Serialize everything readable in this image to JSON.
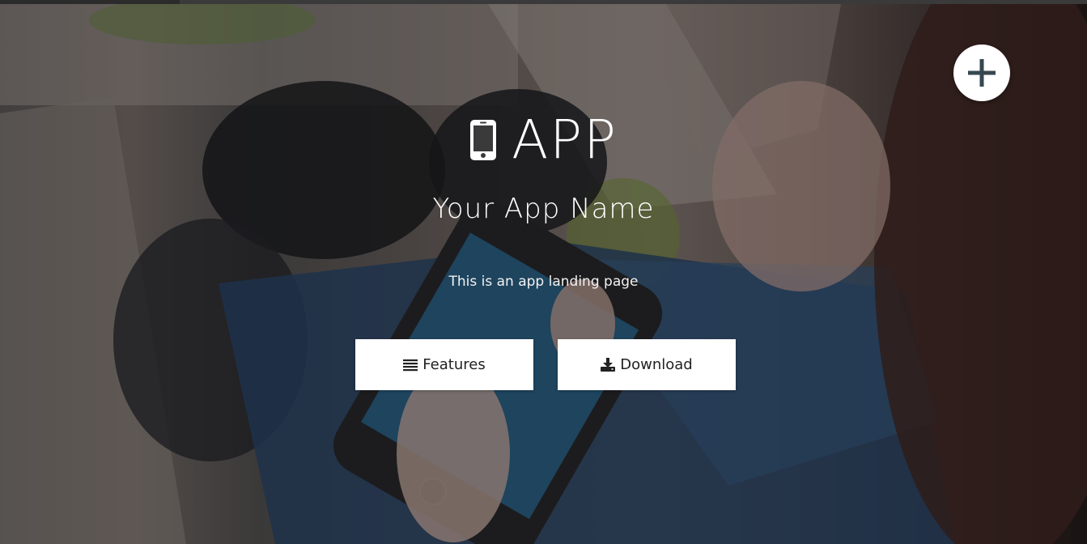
{
  "header": {
    "title": "APP",
    "title_icon": "mobile-phone-icon",
    "app_name": "Your App Name",
    "tagline": "This is an app landing page"
  },
  "actions": {
    "features_label": "Features",
    "features_icon": "list-icon",
    "download_label": "Download",
    "download_icon": "download-icon"
  },
  "fab": {
    "icon": "plus-icon"
  },
  "colors": {
    "button_bg": "#ffffff",
    "button_text": "#222222",
    "fab_icon": "#37474f",
    "overlay": "rgba(10,10,12,0.42)"
  }
}
